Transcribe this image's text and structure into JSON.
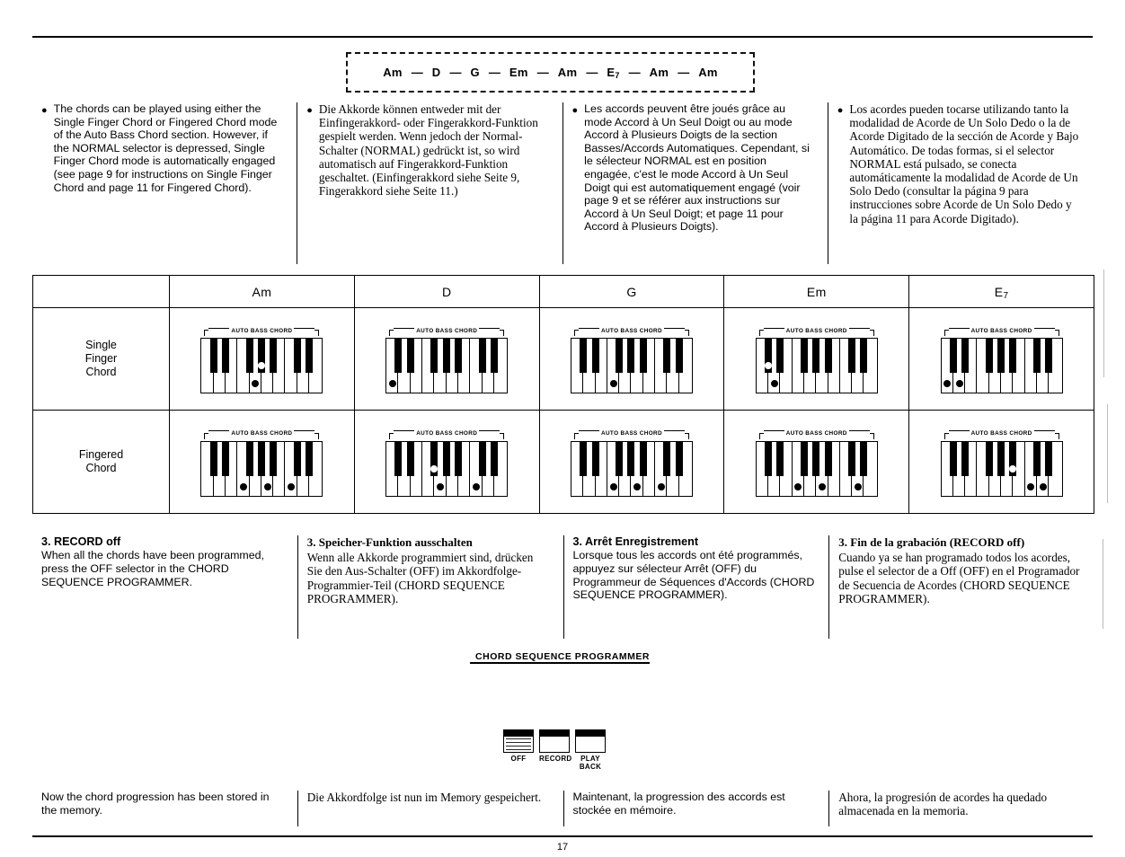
{
  "chord_progression": {
    "tokens": [
      "Am",
      "D",
      "G",
      "Em",
      "Am",
      "E7",
      "Am",
      "Am"
    ],
    "separator": "—"
  },
  "intro": {
    "columns": [
      {
        "lang": "en",
        "text": "The chords can be played using either the Single Finger Chord or Fingered Chord mode of the Auto Bass Chord section. However, if the NORMAL selector is depressed, Single Finger Chord mode is automatically engaged (see page 9 for instructions on Single Finger Chord and page 11 for Fingered Chord)."
      },
      {
        "lang": "de",
        "text": "Die Akkorde können entweder mit der Einfingerakkord- oder Fingerakkord-Funktion gespielt werden. Wenn jedoch der Normal-Schalter (NORMAL) gedrückt ist, so wird automatisch auf Fingerakkord-Funktion geschaltet. (Einfingerakkord siehe Seite 9, Fingerakkord siehe Seite 11.)"
      },
      {
        "lang": "fr",
        "text": "Les accords peuvent être joués grâce au mode Accord à Un Seul Doigt ou au mode Accord à Plusieurs Doigts de la section Basses/Accords Automatiques. Cependant, si le sélecteur NORMAL est en position engagée, c'est le mode Accord à Un Seul Doigt qui est automatiquement engagé (voir page 9 et se référer aux instructions sur Accord à Un Seul Doigt; et page 11 pour Accord à Plusieurs Doigts)."
      },
      {
        "lang": "es",
        "text": "Los acordes pueden tocarse utilizando tanto la modalidad de Acorde de Un Solo Dedo o la de Acorde Digitado de la sección de Acorde y Bajo Automático. De todas formas, si el selector NORMAL está pulsado, se conecta automáticamente la modalidad de Acorde de Un Solo Dedo (consultar la página 9 para instrucciones sobre Acorde de Un Solo Dedo y la página 11 para Acorde Digitado)."
      }
    ]
  },
  "chord_table": {
    "column_headers": [
      "Am",
      "D",
      "G",
      "Em",
      "E7"
    ],
    "row_labels": [
      "Single\nFinger\nChord",
      "Fingered\nChord"
    ],
    "keyboard_caption": "AUTO BASS CHORD",
    "white_key_count": 10,
    "diagrams": {
      "single_finger": [
        {
          "chord": "Am",
          "black_dots_white_keys": [
            5
          ],
          "white_dots_black_keys": [
            4
          ]
        },
        {
          "chord": "D",
          "black_dots_white_keys": [
            1
          ],
          "white_dots_black_keys": []
        },
        {
          "chord": "G",
          "black_dots_white_keys": [
            4
          ],
          "white_dots_black_keys": []
        },
        {
          "chord": "Em",
          "black_dots_white_keys": [
            2
          ],
          "white_dots_black_keys": [
            1
          ]
        },
        {
          "chord": "E7",
          "black_dots_white_keys": [
            1,
            2
          ],
          "white_dots_black_keys": []
        }
      ],
      "fingered": [
        {
          "chord": "Am",
          "black_dots_white_keys": [
            4,
            6,
            8
          ],
          "white_dots_black_keys": []
        },
        {
          "chord": "D",
          "black_dots_white_keys": [
            5,
            8
          ],
          "white_dots_black_keys": [
            3
          ]
        },
        {
          "chord": "G",
          "black_dots_white_keys": [
            4,
            6,
            8
          ],
          "white_dots_black_keys": []
        },
        {
          "chord": "Em",
          "black_dots_white_keys": [
            4,
            6,
            9
          ],
          "white_dots_black_keys": []
        },
        {
          "chord": "E7",
          "black_dots_white_keys": [
            8,
            9
          ],
          "white_dots_black_keys": [
            5
          ]
        }
      ]
    }
  },
  "step3": {
    "columns": [
      {
        "lang": "en",
        "title": "3. RECORD off",
        "body": "When all the chords have been programmed, press the OFF selector in the CHORD SEQUENCE PROGRAMMER."
      },
      {
        "lang": "de",
        "title": "3. Speicher-Funktion ausschalten",
        "body": "Wenn alle Akkorde programmiert sind, drücken Sie den Aus-Schalter (OFF) im Akkordfolge-Programmier-Teil (CHORD SEQUENCE PROGRAMMER)."
      },
      {
        "lang": "fr",
        "title": "3. Arrêt Enregistrement",
        "body": "Lorsque tous les accords ont été programmés, appuyez sur sélecteur Arrêt (OFF) du Programmeur de Séquences d'Accords (CHORD SEQUENCE PROGRAMMER)."
      },
      {
        "lang": "es",
        "title": "3. Fin de la grabación (RECORD off)",
        "body": "Cuando ya se han programado todos los acordes, pulse el selector de a Off (OFF) en el Programador de Secuencia de Acordes (CHORD SEQUENCE PROGRAMMER)."
      }
    ]
  },
  "programmer_panel": {
    "caption": "CHORD SEQUENCE PROGRAMMER",
    "selectors": [
      {
        "label": "OFF",
        "state": "pressed"
      },
      {
        "label": "RECORD",
        "state": "released"
      },
      {
        "label": "PLAY\nBACK",
        "state": "released"
      }
    ]
  },
  "footer": {
    "columns": [
      {
        "lang": "en",
        "text": "Now the chord progression has been stored in the memory."
      },
      {
        "lang": "de",
        "text": "Die Akkordfolge ist nun im Memory gespeichert."
      },
      {
        "lang": "fr",
        "text": "Maintenant, la progression des accords est stockée en mémoire."
      },
      {
        "lang": "es",
        "text": "Ahora, la progresión de acordes ha quedado almacenada en la memoria."
      }
    ]
  },
  "page_number": "17"
}
